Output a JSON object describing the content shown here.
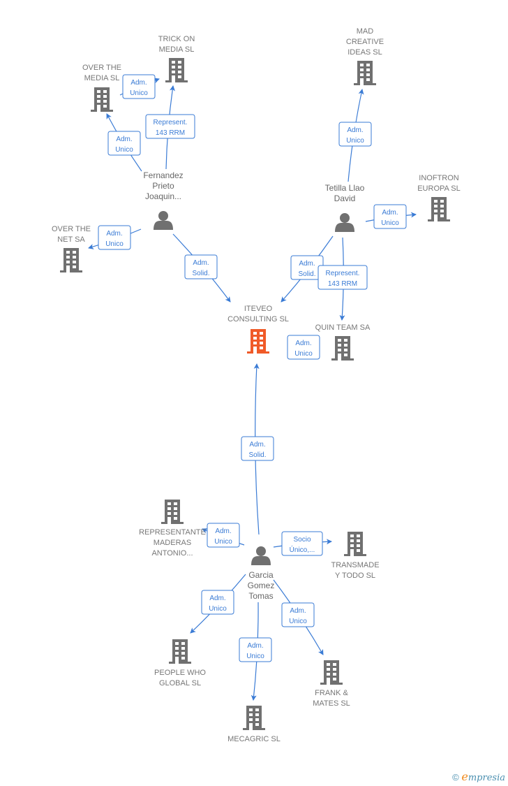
{
  "colors": {
    "edge": "#3a7bd5",
    "node": "#707070",
    "focus": "#f05a28",
    "label": "#777777"
  },
  "nodes": [
    {
      "id": "iteveo",
      "type": "company",
      "focus": true,
      "label": [
        "ITEVEO",
        "CONSULTING SL"
      ]
    },
    {
      "id": "trick",
      "type": "company",
      "label": [
        "TRICK ON",
        "MEDIA SL"
      ]
    },
    {
      "id": "overmedia",
      "type": "company",
      "label": [
        "OVER THE",
        "MEDIA SL"
      ]
    },
    {
      "id": "fernandez",
      "type": "person",
      "label": [
        "Fernandez",
        "Prieto",
        "Joaquin..."
      ]
    },
    {
      "id": "overnet",
      "type": "company",
      "label": [
        "OVER THE",
        "NET SA"
      ]
    },
    {
      "id": "mad",
      "type": "company",
      "label": [
        "MAD",
        "CREATIVE",
        "IDEAS  SL"
      ]
    },
    {
      "id": "tetilla",
      "type": "person",
      "label": [
        "Tetilla Llao",
        "David"
      ]
    },
    {
      "id": "inoftron",
      "type": "company",
      "label": [
        "INOFTRON",
        "EUROPA  SL"
      ]
    },
    {
      "id": "quinteam",
      "type": "company",
      "label": [
        "QUIN TEAM SA"
      ]
    },
    {
      "id": "representante",
      "type": "company",
      "label": [
        "REPRESENTANTE",
        "MADERAS",
        "ANTONIO..."
      ]
    },
    {
      "id": "transmade",
      "type": "company",
      "label": [
        "TRANSMADE",
        "Y TODO SL"
      ]
    },
    {
      "id": "garcia",
      "type": "person",
      "label": [
        "Garcia",
        "Gomez",
        "Tomas"
      ]
    },
    {
      "id": "people",
      "type": "company",
      "label": [
        "PEOPLE WHO",
        "GLOBAL  SL"
      ]
    },
    {
      "id": "mecagric",
      "type": "company",
      "label": [
        "MECAGRIC SL"
      ]
    },
    {
      "id": "frank",
      "type": "company",
      "label": [
        "FRANK &",
        "MATES  SL"
      ]
    }
  ],
  "edges": [
    {
      "from": "fernandez",
      "to": "overmedia",
      "label": [
        "Adm.",
        "Unico"
      ]
    },
    {
      "from": "fernandez",
      "to": "trick",
      "label": [
        "Represent.",
        "143 RRM"
      ]
    },
    {
      "from": "overmedia",
      "to": "trick",
      "label": [
        "Adm.",
        "Unico"
      ]
    },
    {
      "from": "fernandez",
      "to": "overnet",
      "label": [
        "Adm.",
        "Unico"
      ]
    },
    {
      "from": "fernandez",
      "to": "iteveo",
      "label": [
        "Adm.",
        "Solid."
      ]
    },
    {
      "from": "tetilla",
      "to": "mad",
      "label": [
        "Adm.",
        "Unico"
      ]
    },
    {
      "from": "tetilla",
      "to": "inoftron",
      "label": [
        "Adm.",
        "Unico"
      ]
    },
    {
      "from": "tetilla",
      "to": "iteveo",
      "label": [
        "Adm.",
        "Solid."
      ]
    },
    {
      "from": "tetilla",
      "to": "quinteam",
      "label": [
        "Represent.",
        "143 RRM"
      ]
    },
    {
      "from": "quinteam",
      "to": "iteveo",
      "label": [
        "Adm.",
        "Unico"
      ]
    },
    {
      "from": "garcia",
      "to": "iteveo",
      "label": [
        "Adm.",
        "Solid."
      ]
    },
    {
      "from": "garcia",
      "to": "representante",
      "label": [
        "Adm.",
        "Unico"
      ]
    },
    {
      "from": "garcia",
      "to": "transmade",
      "label": [
        "Socio",
        "Único,..."
      ]
    },
    {
      "from": "garcia",
      "to": "people",
      "label": [
        "Adm.",
        "Unico"
      ]
    },
    {
      "from": "garcia",
      "to": "mecagric",
      "label": [
        "Adm.",
        "Unico"
      ]
    },
    {
      "from": "garcia",
      "to": "frank",
      "label": [
        "Adm.",
        "Unico"
      ]
    }
  ],
  "footer": {
    "copyright": "©",
    "brand_e": "e",
    "brand_rest": "mpresia"
  }
}
